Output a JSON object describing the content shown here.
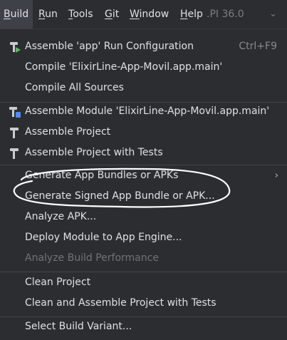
{
  "menubar": {
    "build": {
      "ul": "B",
      "rest": "uild"
    },
    "run": {
      "ul": "R",
      "rest": "un"
    },
    "tools": {
      "ul": "T",
      "rest": "ools"
    },
    "git": {
      "ul": "G",
      "rest": "it"
    },
    "window": {
      "ul": "W",
      "rest": "indow"
    },
    "help": {
      "ul": "H",
      "rest": "elp"
    },
    "api_hint": ".PI 36.0"
  },
  "menu": {
    "assemble_app_run": {
      "label": "Assemble 'app' Run Configuration",
      "shortcut": "Ctrl+F9"
    },
    "compile_main": {
      "label": "Compile 'ElixirLine-App-Movil.app.main'"
    },
    "compile_all": {
      "label": "Compile All Sources"
    },
    "assemble_module": {
      "label": "Assemble Module 'ElixirLine-App-Movil.app.main'"
    },
    "assemble_project": {
      "label": "Assemble Project"
    },
    "assemble_project_tests": {
      "label": "Assemble Project with Tests"
    },
    "generate_bundles": {
      "label": "Generate App Bundles or APKs"
    },
    "generate_signed": {
      "label": "Generate Signed App Bundle or APK..."
    },
    "analyze_apk": {
      "label": "Analyze APK..."
    },
    "deploy_module": {
      "label": "Deploy Module to App Engine..."
    },
    "analyze_build_perf": {
      "label": "Analyze Build Performance"
    },
    "clean_project": {
      "label": "Clean Project"
    },
    "clean_assemble_tests": {
      "label": "Clean and Assemble Project with Tests"
    },
    "select_variant": {
      "label": "Select Build Variant..."
    }
  },
  "icons": {
    "hammer_color": "#c9ccd1",
    "accent_green": "#5fb865",
    "accent_blue": "#548af7"
  },
  "annotation": {
    "stroke_color": "#ffffff"
  }
}
